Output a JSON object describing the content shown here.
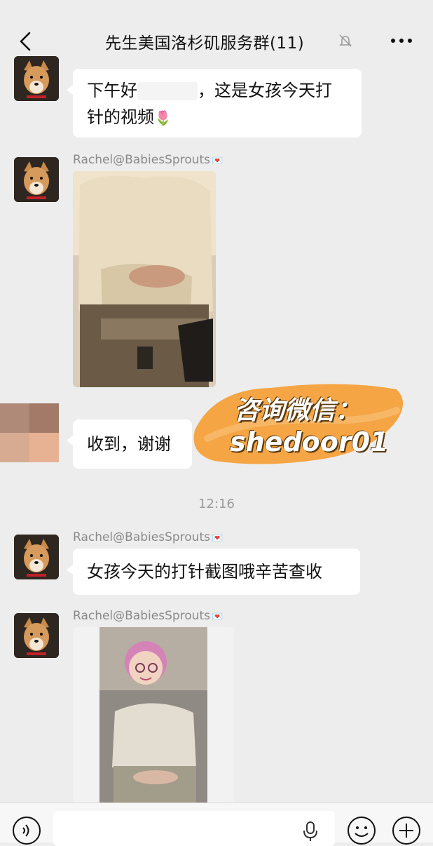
{
  "header": {
    "title": "先生美国洛杉矶服务群(11)",
    "back_icon": "chevron-left-icon",
    "mute_icon": "bell-slash-icon",
    "more_icon": "ellipsis-icon"
  },
  "messages": [
    {
      "type": "text",
      "sender": "",
      "parts": [
        "下午好",
        "，这是女孩今天打针的视频"
      ],
      "emoji": "🌷"
    },
    {
      "type": "video",
      "sender": "Rachel@BabiesSprouts"
    },
    {
      "type": "text-self",
      "sender": "",
      "text": "收到，谢谢"
    },
    {
      "type": "timestamp",
      "text": "12:16"
    },
    {
      "type": "text",
      "sender": "Rachel@BabiesSprouts",
      "text": "女孩今天的打针截图哦辛苦查收"
    },
    {
      "type": "image",
      "sender": "Rachel@BabiesSprouts"
    }
  ],
  "watermark": {
    "line1": "咨询微信：",
    "line2": "shedoor01",
    "color": "#f5a544"
  },
  "input_bar": {
    "placeholder": "",
    "voice_icon": "voice-wave-icon",
    "mic_icon": "microphone-icon",
    "emoji_icon": "smile-icon",
    "plus_icon": "plus-icon"
  },
  "colors": {
    "background": "#ededed",
    "bubble": "#ffffff",
    "sender_name": "#8a8a8a"
  }
}
